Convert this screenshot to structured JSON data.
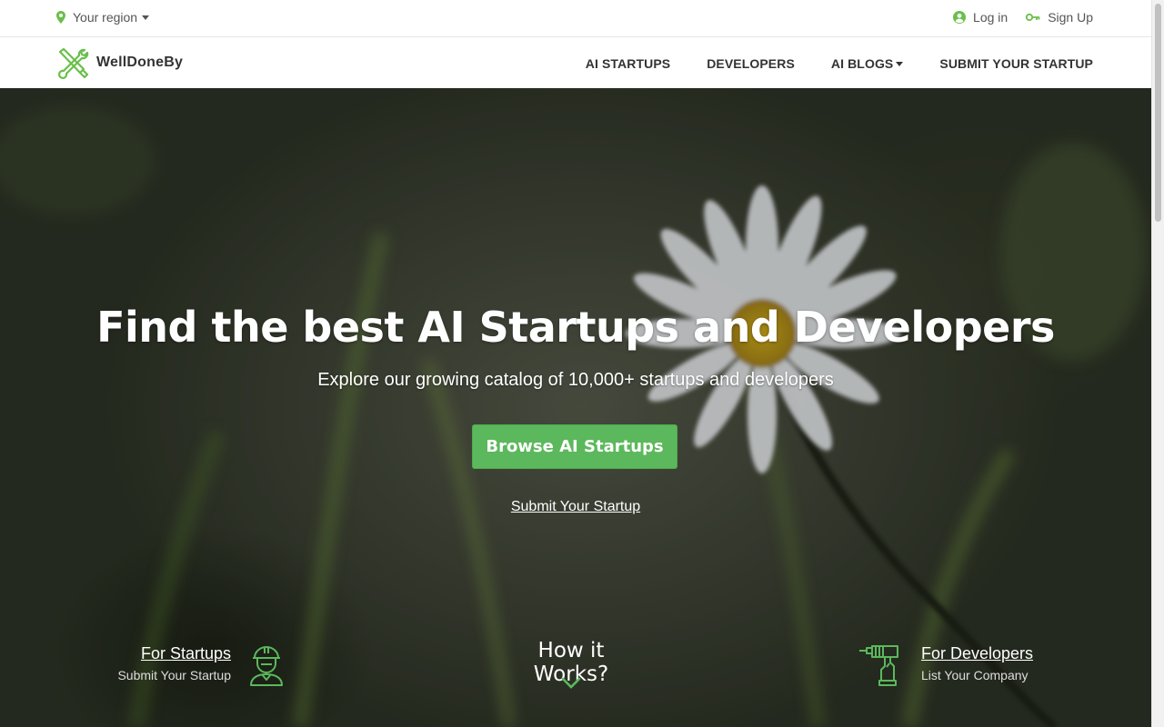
{
  "topbar": {
    "region_label": "Your region",
    "login_label": "Log in",
    "signup_label": "Sign Up"
  },
  "navbar": {
    "brand": "WellDoneBy",
    "links": [
      {
        "label": "AI STARTUPS"
      },
      {
        "label": "DEVELOPERS"
      },
      {
        "label": "AI BLOGS",
        "dropdown": true
      },
      {
        "label": "SUBMIT YOUR STARTUP"
      }
    ]
  },
  "hero": {
    "title": "Find the best AI Startups and Developers",
    "subtitle": "Explore our growing catalog of 10,000+ startups and developers",
    "cta_label": "Browse AI Startups",
    "submit_link": "Submit Your Startup",
    "how_it_works": "How it Works?",
    "for_startups": {
      "title": "For Startups",
      "subtitle": "Submit Your Startup",
      "icon": "construction-worker-icon"
    },
    "for_developers": {
      "title": "For Developers",
      "subtitle": "List Your Company",
      "icon": "power-drill-icon"
    }
  },
  "colors": {
    "accent": "#5cb85c",
    "icon_green": "#6abf4b",
    "nav_text": "#333333"
  }
}
